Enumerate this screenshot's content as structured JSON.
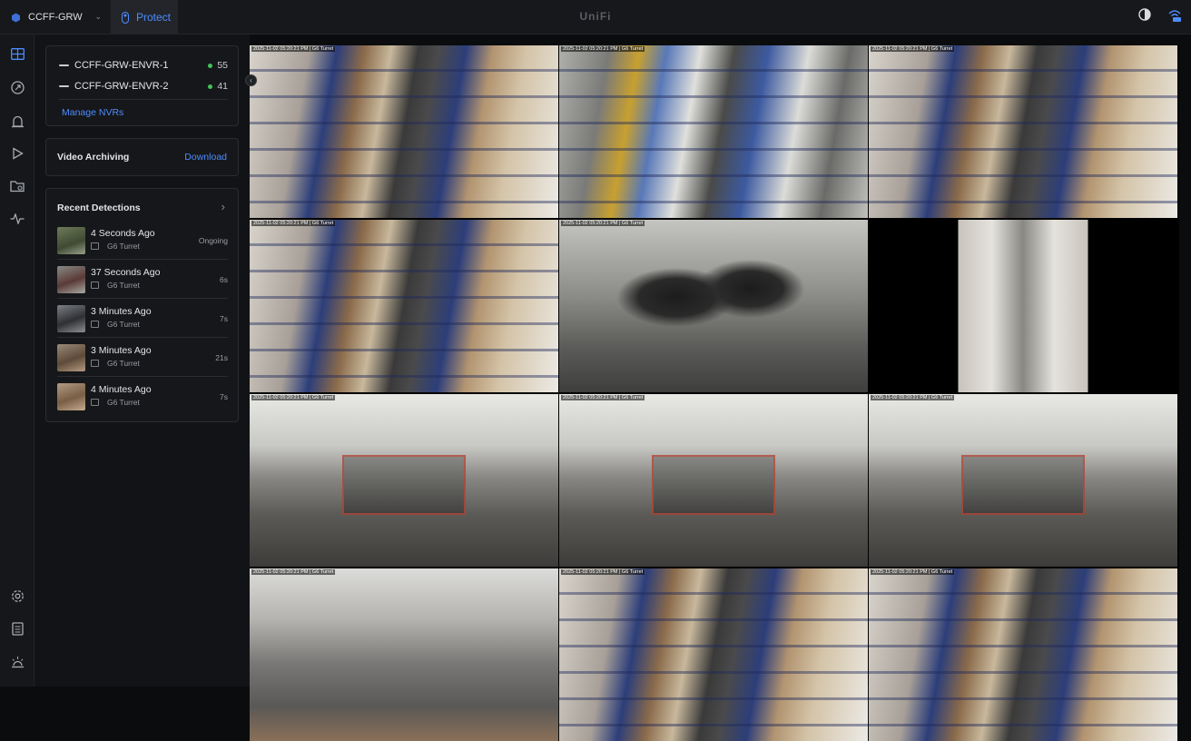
{
  "topbar": {
    "site_name": "CCFF-GRW",
    "app_tab": "Protect",
    "brand": "UniFi"
  },
  "sidebar": {
    "items": [
      "grid-icon",
      "map-icon",
      "alarm-icon",
      "play-icon",
      "folder-icon",
      "activity-icon"
    ],
    "bottom_items": [
      "gear-icon",
      "log-icon",
      "bulb-icon"
    ]
  },
  "nvrs": [
    {
      "name": "CCFF-GRW-ENVR-1",
      "count": "55"
    },
    {
      "name": "CCFF-GRW-ENVR-2",
      "count": "41"
    }
  ],
  "manage_nvrs": "Manage NVRs",
  "archiving": {
    "title": "Video Archiving",
    "action": "Download"
  },
  "detections": {
    "title": "Recent Detections",
    "items": [
      {
        "when": "4 Seconds Ago",
        "camera": "G6 Turret",
        "duration": "Ongoing"
      },
      {
        "when": "37 Seconds Ago",
        "camera": "G6 Turret",
        "duration": "6s"
      },
      {
        "when": "3 Minutes Ago",
        "camera": "G6 Turret",
        "duration": "7s"
      },
      {
        "when": "3 Minutes Ago",
        "camera": "G6 Turret",
        "duration": "21s"
      },
      {
        "when": "4 Minutes Ago",
        "camera": "G6 Turret",
        "duration": "7s"
      }
    ]
  },
  "cameras": [
    {
      "overlay": "2025-11-02 05:20:21 PM | G6 Turret",
      "scene": "warehouse-aisle"
    },
    {
      "overlay": "2025-11-02 05:20:21 PM | G6 Turret",
      "scene": "kegs-racks"
    },
    {
      "overlay": "2025-11-02 05:20:21 PM | G6 Turret",
      "scene": "warehouse-aisle"
    },
    {
      "overlay": "2025-11-02 05:20:21 PM | G6 Turret",
      "scene": "warehouse-aisle"
    },
    {
      "overlay": "2025-11-02 05:20:21 PM | G6 Turret",
      "scene": "tanks-room"
    },
    {
      "overlay": "",
      "scene": "entrance-hall"
    },
    {
      "overlay": "2025-11-02 05:20:21 PM | G6 Turret",
      "scene": "brewery-floor"
    },
    {
      "overlay": "2025-11-02 05:20:21 PM | G6 Turret",
      "scene": "brewery-floor"
    },
    {
      "overlay": "2025-11-02 05:20:21 PM | G6 Turret",
      "scene": "brewery-floor"
    },
    {
      "overlay": "2025-11-02 05:20:21 PM | G6 Turret",
      "scene": "lab-room"
    },
    {
      "overlay": "2025-11-02 05:20:21 PM | G6 Turret",
      "scene": "warehouse-aisle"
    },
    {
      "overlay": "2025-11-02 05:20:21 PM | G6 Turret",
      "scene": "warehouse-aisle"
    }
  ],
  "colors": {
    "accent": "#4d8cff",
    "online": "#3fc457",
    "background": "#0b0c0e"
  }
}
